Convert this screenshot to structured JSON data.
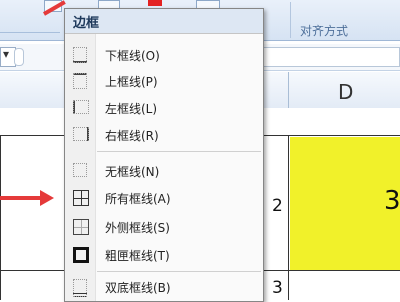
{
  "ribbon": {
    "group_label": "对齐方式"
  },
  "sheet": {
    "column_d": "D",
    "row_numbers": [
      "2",
      "3"
    ],
    "partial_value": "3"
  },
  "menu": {
    "title": "边框",
    "items": [
      {
        "label": "下框线(O)",
        "icon": "bottom-border-icon"
      },
      {
        "label": "上框线(P)",
        "icon": "top-border-icon"
      },
      {
        "label": "左框线(L)",
        "icon": "left-border-icon"
      },
      {
        "label": "右框线(R)",
        "icon": "right-border-icon"
      },
      {
        "label": "无框线(N)",
        "icon": "no-border-icon"
      },
      {
        "label": "所有框线(A)",
        "icon": "all-borders-icon"
      },
      {
        "label": "外侧框线(S)",
        "icon": "outside-borders-icon"
      },
      {
        "label": "粗匣框线(T)",
        "icon": "thick-box-border-icon"
      },
      {
        "label": "双底框线(B)",
        "icon": "double-bottom-border-icon"
      }
    ]
  },
  "colors": {
    "highlight": "#f1f12a",
    "arrow": "#e53a3a",
    "menu_title_bg": "#dde7f3"
  }
}
